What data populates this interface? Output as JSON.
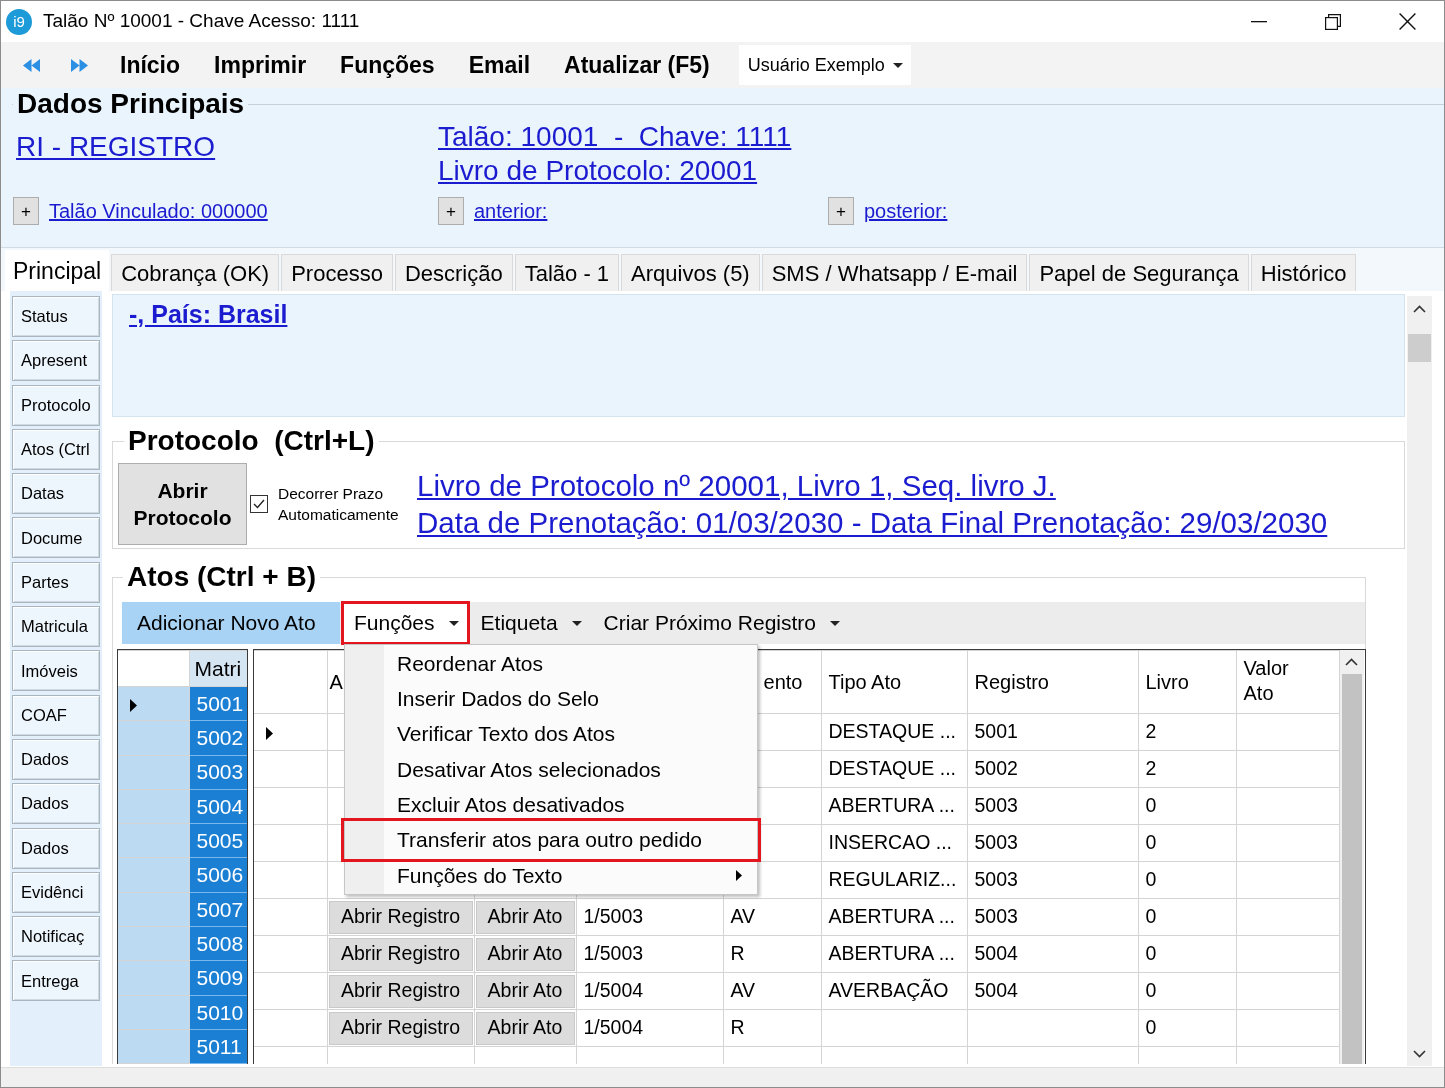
{
  "window": {
    "logo": "i9",
    "title": "Talão Nº 10001 - Chave Acesso: 1111"
  },
  "menu_bar": {
    "items": [
      "Início",
      "Imprimir",
      "Funções",
      "Email",
      "Atualizar (F5)"
    ],
    "user_dropdown": "Usuário Exemplo"
  },
  "dados_principais": {
    "title": "Dados Principais",
    "service_link": "RI - REGISTRO",
    "talao_link": "Talão: 10001  -  Chave: 1111",
    "livro_link": "Livro de Protocolo: 20001",
    "related": [
      {
        "button": "+",
        "link": "Talão Vinculado: 000000"
      },
      {
        "button": "+",
        "link": "anterior:"
      },
      {
        "button": "+",
        "link": "posterior:"
      }
    ]
  },
  "tabs": [
    {
      "label": "Principal",
      "selected": true
    },
    {
      "label": "Cobrança (OK)",
      "selected": false
    },
    {
      "label": "Processo",
      "selected": false
    },
    {
      "label": "Descrição",
      "selected": false
    },
    {
      "label": "Talão - 1",
      "selected": false
    },
    {
      "label": "Arquivos (5)",
      "selected": false
    },
    {
      "label": "SMS / Whatsapp / E-mail",
      "selected": false
    },
    {
      "label": "Papel de Segurança",
      "selected": false
    },
    {
      "label": "Histórico",
      "selected": false
    }
  ],
  "sidebar": {
    "buttons": [
      "Status",
      "Apresent",
      "Protocolo",
      "Atos (Ctrl",
      "Datas",
      "Docume",
      "Partes",
      "Matricula",
      "Imóveis",
      "COAF",
      "Dados",
      "Dados",
      "Dados",
      "Evidênci",
      "Notificaç",
      "Entrega"
    ]
  },
  "address": {
    "link": "-, País: Brasil"
  },
  "protocolo": {
    "title": "Protocolo  (Ctrl+L)",
    "open_button": "Abrir Protocolo",
    "auto_deadline": {
      "label": "Decorrer Prazo Automaticamente",
      "checked": true
    },
    "links": [
      "Livro de Protocolo nº 20001, Livro 1, Seq. livro J.",
      "Data de Prenotação: 01/03/2030 - Data Final Prenotação: 29/03/2030"
    ]
  },
  "atos": {
    "title": "Atos (Ctrl + B)",
    "toolbar": [
      {
        "kind": "action",
        "label": "Adicionar Novo Ato",
        "expanded": false,
        "highlighted": false
      },
      {
        "kind": "dropdown",
        "label": "Funções",
        "expanded": true,
        "highlighted": true,
        "menu": [
          {
            "label": "Reordenar Atos",
            "highlighted": false,
            "submenu": false
          },
          {
            "label": "Inserir Dados do Selo",
            "highlighted": false,
            "submenu": false
          },
          {
            "label": "Verificar Texto dos Atos",
            "highlighted": false,
            "submenu": false
          },
          {
            "label": "Desativar Atos selecionados",
            "highlighted": false,
            "submenu": false
          },
          {
            "label": "Excluir Atos desativados",
            "highlighted": false,
            "submenu": false
          },
          {
            "label": "Transferir atos para outro pedido",
            "highlighted": true,
            "submenu": false
          },
          {
            "label": "Funções do Texto",
            "highlighted": false,
            "submenu": true
          }
        ]
      },
      {
        "kind": "dropdown",
        "label": "Etiqueta",
        "expanded": false,
        "highlighted": false
      },
      {
        "kind": "dropdown",
        "label": "Criar Próximo Registro",
        "expanded": false,
        "highlighted": false
      }
    ],
    "matricula_grid": {
      "header": "Matri",
      "rows": [
        {
          "value": "5001",
          "selected": true,
          "current": true
        },
        {
          "value": "5002",
          "selected": true,
          "current": false
        },
        {
          "value": "5003",
          "selected": true,
          "current": false
        },
        {
          "value": "5004",
          "selected": true,
          "current": false
        },
        {
          "value": "5005",
          "selected": true,
          "current": false
        },
        {
          "value": "5006",
          "selected": true,
          "current": false
        },
        {
          "value": "5007",
          "selected": true,
          "current": false
        },
        {
          "value": "5008",
          "selected": true,
          "current": false
        },
        {
          "value": "5009",
          "selected": true,
          "current": false
        },
        {
          "value": "5010",
          "selected": true,
          "current": false
        },
        {
          "value": "5011",
          "selected": true,
          "current": false
        }
      ]
    },
    "atos_grid": {
      "header": {
        "column_1": "A",
        "column_4": "ento",
        "tipo_ato": "Tipo Ato",
        "registro": "Registro",
        "livro": "Livro",
        "valor_ato": "Valor Ato"
      },
      "rows": [
        {
          "current": true,
          "tipo_ato": "DESTAQUE ...",
          "registro": "5001",
          "livro": "2"
        },
        {
          "current": false,
          "tipo_ato": "DESTAQUE ...",
          "registro": "5002",
          "livro": "2"
        },
        {
          "current": false,
          "tipo_ato": "ABERTURA ...",
          "registro": "5003",
          "livro": "0"
        },
        {
          "current": false,
          "tipo_ato": "INSERCAO ...",
          "registro": "5003",
          "livro": "0"
        },
        {
          "current": false,
          "tipo_ato": "REGULARIZ...",
          "registro": "5003",
          "livro": "0"
        },
        {
          "current": false,
          "column_1": "Abrir Registro",
          "column_2": "Abrir Ato",
          "column_3": "1/5003",
          "column_4": "AV",
          "tipo_ato": "ABERTURA ...",
          "registro": "5003",
          "livro": "0"
        },
        {
          "current": false,
          "column_1": "Abrir Registro",
          "column_2": "Abrir Ato",
          "column_3": "1/5003",
          "column_4": "R",
          "tipo_ato": "ABERTURA ...",
          "registro": "5004",
          "livro": "0"
        },
        {
          "current": false,
          "column_1": "Abrir Registro",
          "column_2": "Abrir Ato",
          "column_3": "1/5004",
          "column_4": "AV",
          "tipo_ato": "AVERBAÇÃO",
          "registro": "5004",
          "livro": "0"
        },
        {
          "current": false,
          "column_1": "Abrir Registro",
          "column_2": "Abrir Ato",
          "column_3": "1/5004",
          "column_4": "R",
          "livro": "0"
        }
      ]
    }
  }
}
